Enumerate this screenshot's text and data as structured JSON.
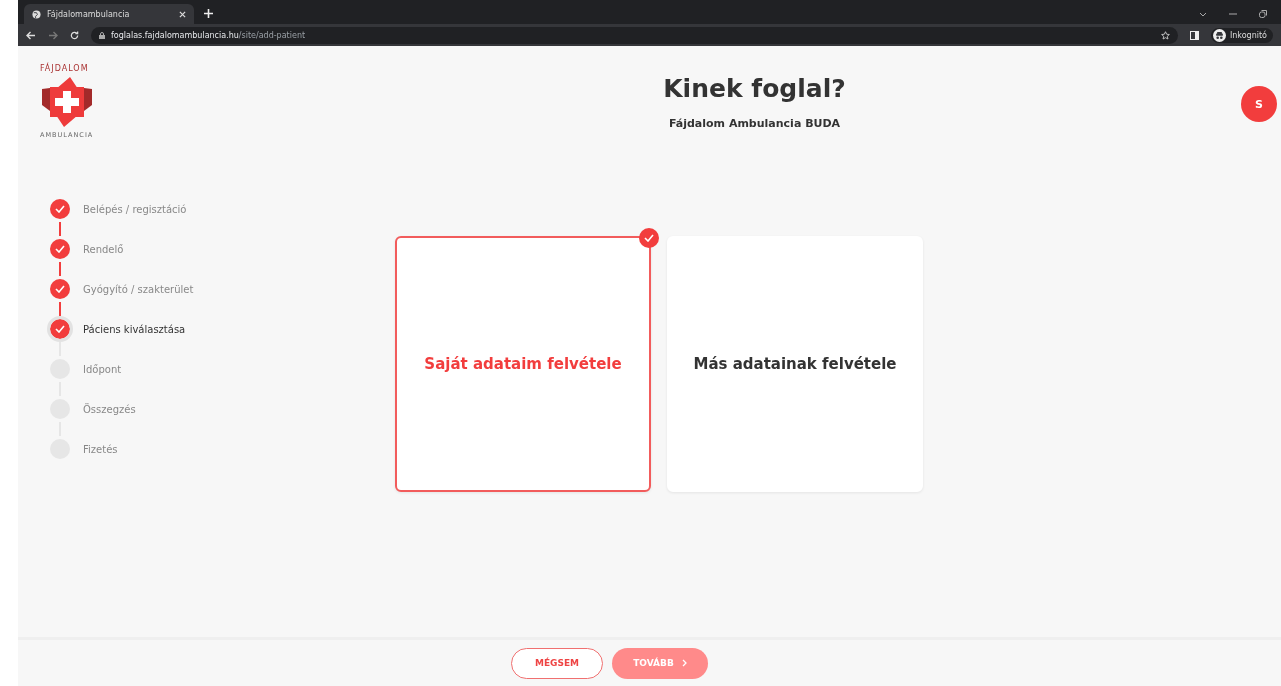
{
  "browser": {
    "tab_title": "Fájdalomambulancia",
    "url_host": "foglalas.fajdalomambulancia.hu",
    "url_path": "/site/add-patient",
    "profile": "Inkognitó"
  },
  "logo": {
    "top": "FÁJDALOM",
    "bottom": "AMBULANCIA"
  },
  "header": {
    "title": "Kinek foglal?",
    "subtitle": "Fájdalom Ambulancia BUDA",
    "avatar": "S"
  },
  "steps": [
    {
      "label": "Belépés / regisztáció",
      "done": true,
      "selected": false
    },
    {
      "label": "Rendelő",
      "done": true,
      "selected": false
    },
    {
      "label": "Gyógyító / szakterület",
      "done": true,
      "selected": false
    },
    {
      "label": "Páciens kiválasztása",
      "done": true,
      "selected": true
    },
    {
      "label": "Időpont",
      "done": false,
      "selected": false
    },
    {
      "label": "Összegzés",
      "done": false,
      "selected": false
    },
    {
      "label": "Fizetés",
      "done": false,
      "selected": false
    }
  ],
  "options": [
    {
      "label": "Saját adataim felvétele",
      "selected": true
    },
    {
      "label": "Más adatainak felvétele",
      "selected": false
    }
  ],
  "footer": {
    "cancel": "MÉGSEM",
    "next": "TOVÁBB",
    "next_disabled": true
  }
}
